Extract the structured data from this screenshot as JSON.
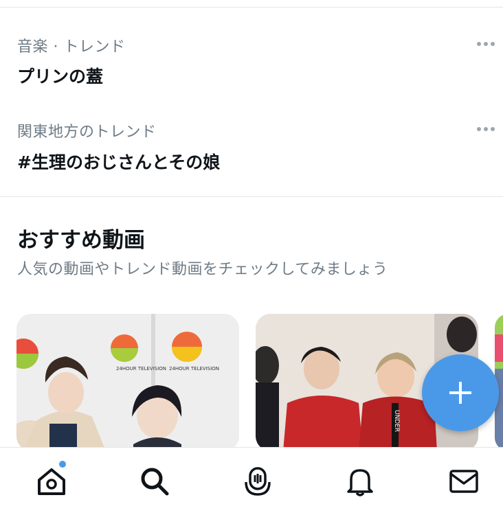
{
  "trends": [
    {
      "meta": "音楽 · トレンド",
      "title": "プリンの蓋"
    },
    {
      "meta": "関東地方のトレンド",
      "title": "#生理のおじさんとその娘"
    }
  ],
  "section": {
    "title": "おすすめ動画",
    "subtitle": "人気の動画やトレンド動画をチェックしてみましょう"
  },
  "videos": [
    {
      "watermark": "24HOUR TELEVISION"
    },
    {
      "watermark": "UNDER"
    }
  ],
  "colors": {
    "accent": "#4a99e9",
    "text_primary": "#0f1419",
    "text_secondary": "#6e7b86",
    "divider": "#e1e6ea"
  },
  "icons": {
    "fab": "plus-icon",
    "nav": [
      "home-icon",
      "search-icon",
      "spaces-icon",
      "bell-icon",
      "mail-icon"
    ]
  }
}
